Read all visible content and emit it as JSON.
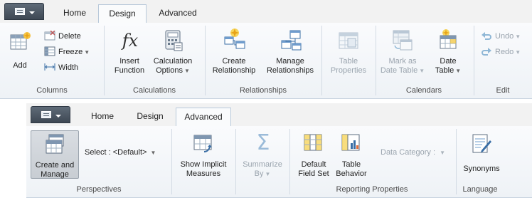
{
  "top_ribbon": {
    "tabs": [
      {
        "label": "Home",
        "active": false
      },
      {
        "label": "Design",
        "active": true
      },
      {
        "label": "Advanced",
        "active": false
      }
    ],
    "groups": [
      {
        "label": "Columns"
      },
      {
        "label": "Calculations"
      },
      {
        "label": "Relationships"
      },
      {
        "label": "Table Properties"
      },
      {
        "label": "Calendars"
      },
      {
        "label": "Edit"
      }
    ],
    "buttons": {
      "add": "Add",
      "delete": "Delete",
      "freeze": "Freeze",
      "width": "Width",
      "insert_function": [
        "Insert",
        "Function"
      ],
      "calculation_options": [
        "Calculation",
        "Options"
      ],
      "create_relationship": [
        "Create",
        "Relationship"
      ],
      "manage_relationships": [
        "Manage",
        "Relationships"
      ],
      "table_properties": [
        "Table",
        "Properties"
      ],
      "mark_as_date_table": [
        "Mark as",
        "Date Table"
      ],
      "date_table": [
        "Date",
        "Table"
      ],
      "undo": "Undo",
      "redo": "Redo"
    }
  },
  "bottom_ribbon": {
    "tabs": [
      {
        "label": "Home",
        "active": false
      },
      {
        "label": "Design",
        "active": false
      },
      {
        "label": "Advanced",
        "active": true
      }
    ],
    "groups": [
      {
        "label": "Perspectives"
      },
      {
        "label": "Reporting Properties"
      },
      {
        "label": "Language"
      }
    ],
    "buttons": {
      "create_and_manage": [
        "Create and",
        "Manage"
      ],
      "select_label": "Select :",
      "select_value": "<Default>",
      "show_implicit_measures": [
        "Show Implicit",
        "Measures"
      ],
      "summarize_by": [
        "Summarize",
        "By"
      ],
      "default_field_set": [
        "Default",
        "Field Set"
      ],
      "table_behavior": [
        "Table",
        "Behavior"
      ],
      "data_category_label": "Data Category :",
      "data_category_value": "",
      "synonyms": "Synonyms"
    }
  },
  "colors": {
    "accent": "#3a6ea5",
    "disabled_text": "#9aa4ae",
    "ribbon_background": "#f4f6f9"
  }
}
